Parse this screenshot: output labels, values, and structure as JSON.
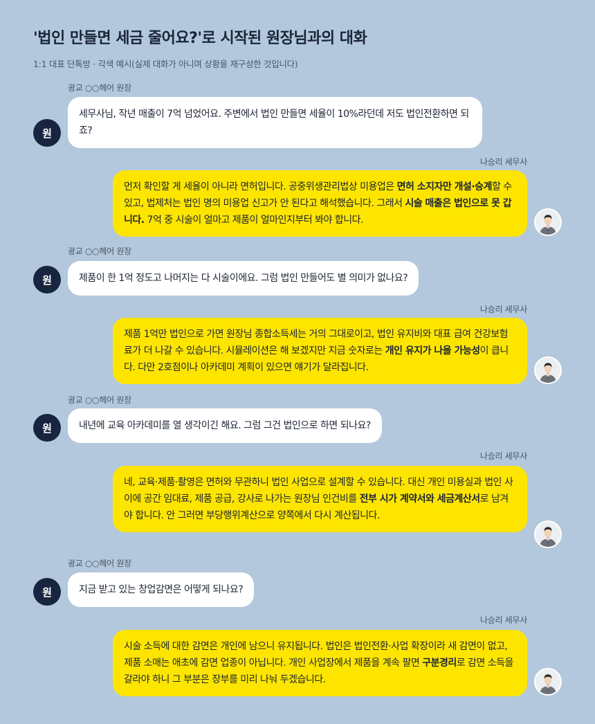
{
  "header": {
    "title": "'법인 만들면 세금 줄어요?'로 시작된 원장님과의 대화",
    "subtitle": "1:1 대표 단톡방 · 각색 예시(실제 대화가 아니며 상황을 재구성한 것입니다)"
  },
  "participants": {
    "owner_name": "광교 ○○헤어 원장",
    "owner_avatar": "원",
    "advisor_name": "나승리 세무사"
  },
  "colors": {
    "background": "#b3c8dc",
    "owner_bubble": "#ffffff",
    "advisor_bubble": "#fee500",
    "owner_avatar": "#172540"
  },
  "messages": [
    {
      "sender": "광교 ○○헤어 원장",
      "text": "세무사님, 작년 매출이 7억 넘었어요. 주변에서 법인 만들면 세율이 10%라던데 저도 법인전환하면 되죠?"
    },
    {
      "sender": "나승리 세무사",
      "segments": [
        {
          "t": "먼저 확인할 게 세율이 아니라 면허입니다. 공중위생관리법상 미용업은 "
        },
        {
          "t": "면허 소지자만 개설·승계",
          "bold": true
        },
        {
          "t": "할 수 있고, 법제처는 법인 명의 미용업 신고가 안 된다고 해석했습니다. 그래서 "
        },
        {
          "t": "시술 매출은 법인으로 못 갑니다.",
          "bold": true
        },
        {
          "t": " 7억 중 시술이 얼마고 제품이 얼마인지부터 봐야 합니다."
        }
      ]
    },
    {
      "sender": "광교 ○○헤어 원장",
      "text": "제품이 한 1억 정도고 나머지는 다 시술이에요. 그럼 법인 만들어도 별 의미가 없나요?"
    },
    {
      "sender": "나승리 세무사",
      "segments": [
        {
          "t": "제품 1억만 법인으로 가면 원장님 종합소득세는 거의 그대로이고, 법인 유지비와 대표 급여 건강보험료가 더 나갈 수 있습니다. 시뮬레이션은 해 보겠지만 지금 숫자로는 "
        },
        {
          "t": "개인 유지가 나을 가능성",
          "bold": true
        },
        {
          "t": "이 큽니다. 다만 2호점이나 아카데미 계획이 있으면 얘기가 달라집니다."
        }
      ]
    },
    {
      "sender": "광교 ○○헤어 원장",
      "text": "내년에 교육 아카데미를 열 생각이긴 해요. 그럼 그건 법인으로 하면 되나요?"
    },
    {
      "sender": "나승리 세무사",
      "segments": [
        {
          "t": "네, 교육·제품·촬영은 면허와 무관하니 법인 사업으로 설계할 수 있습니다. 대신 개인 미용실과 법인 사이에 공간 임대료, 제품 공급, 강사로 나가는 원장님 인건비를 "
        },
        {
          "t": "전부 시가 계약서와 세금계산서",
          "bold": true
        },
        {
          "t": "로 남겨야 합니다. 안 그러면 부당행위계산으로 양쪽에서 다시 계산됩니다."
        }
      ]
    },
    {
      "sender": "광교 ○○헤어 원장",
      "text": "지금 받고 있는 창업감면은 어떻게 되나요?"
    },
    {
      "sender": "나승리 세무사",
      "segments": [
        {
          "t": "시술 소득에 대한 감면은 개인에 남으니 유지됩니다. 법인은 법인전환·사업 확장이라 새 감면이 없고, 제품 소매는 애초에 감면 업종이 아닙니다. 개인 사업장에서 제품을 계속 팔면 "
        },
        {
          "t": "구분경리",
          "bold": true
        },
        {
          "t": "로 감면 소득을 갈라야 하니 그 부분은 장부를 미리 나눠 두겠습니다."
        }
      ]
    }
  ]
}
